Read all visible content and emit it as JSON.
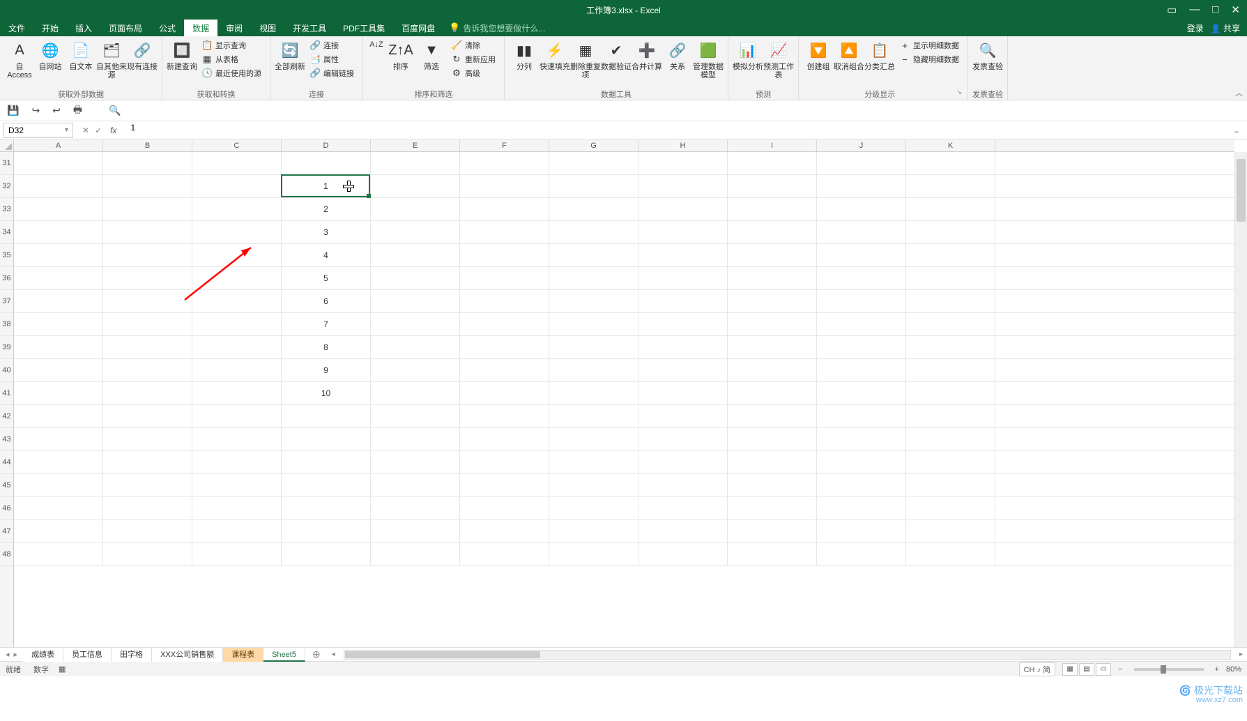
{
  "title_bar": {
    "document_title": "工作簿3.xlsx - Excel",
    "ribbon_options_icon": "▭",
    "minimize": "—",
    "maximize": "□",
    "close": "✕"
  },
  "tabs": {
    "items": [
      "文件",
      "开始",
      "插入",
      "页面布局",
      "公式",
      "数据",
      "审阅",
      "视图",
      "开发工具",
      "PDF工具集",
      "百度网盘"
    ],
    "active_index": 5,
    "tell_me_placeholder": "告诉我您想要做什么...",
    "login": "登录",
    "share": "共享"
  },
  "ribbon": {
    "groups": [
      {
        "label": "获取外部数据",
        "big": [
          {
            "label": "自 Access",
            "icon": "A",
            "name": "from-access-button"
          },
          {
            "label": "自网站",
            "icon": "🌐",
            "name": "from-web-button"
          },
          {
            "label": "自文本",
            "icon": "📄",
            "name": "from-text-button"
          },
          {
            "label": "自其他来源",
            "icon": "🗂",
            "name": "from-other-sources-button"
          },
          {
            "label": "现有连接",
            "icon": "🔗",
            "name": "existing-connections-button"
          }
        ],
        "stack": []
      },
      {
        "label": "获取和转换",
        "big": [
          {
            "label": "新建查询",
            "icon": "🔲",
            "name": "new-query-button"
          }
        ],
        "stack": [
          {
            "label": "显示查询",
            "icon": "📋",
            "name": "show-queries-button"
          },
          {
            "label": "从表格",
            "icon": "▦",
            "name": "from-table-button"
          },
          {
            "label": "最近使用的源",
            "icon": "🕓",
            "name": "recent-sources-button"
          }
        ]
      },
      {
        "label": "连接",
        "big": [
          {
            "label": "全部刷新",
            "icon": "🔄",
            "name": "refresh-all-button"
          }
        ],
        "stack": [
          {
            "label": "连接",
            "icon": "🔗",
            "name": "connections-button"
          },
          {
            "label": "属性",
            "icon": "📑",
            "name": "properties-button"
          },
          {
            "label": "编辑链接",
            "icon": "🔗",
            "name": "edit-links-button"
          }
        ]
      },
      {
        "label": "排序和筛选",
        "big": [
          {
            "label": "",
            "icon": "A↓Z",
            "name": "sort-az-button",
            "mini": true
          },
          {
            "label": "排序",
            "icon": "Z↑A",
            "name": "sort-dialog-button"
          },
          {
            "label": "筛选",
            "icon": "▼",
            "name": "filter-button"
          }
        ],
        "stack": [
          {
            "label": "清除",
            "icon": "🧹",
            "name": "clear-filter-button"
          },
          {
            "label": "重新应用",
            "icon": "↻",
            "name": "reapply-button"
          },
          {
            "label": "高级",
            "icon": "⚙",
            "name": "advanced-filter-button"
          }
        ]
      },
      {
        "label": "数据工具",
        "big": [
          {
            "label": "分列",
            "icon": "▮▮",
            "name": "text-to-columns-button"
          },
          {
            "label": "快速填充",
            "icon": "⚡",
            "name": "flash-fill-button"
          },
          {
            "label": "删除重复项",
            "icon": "▦",
            "name": "remove-duplicates-button"
          },
          {
            "label": "数据验证",
            "icon": "✔",
            "name": "data-validation-button"
          },
          {
            "label": "合并计算",
            "icon": "➕",
            "name": "consolidate-button"
          },
          {
            "label": "关系",
            "icon": "🔗",
            "name": "relationships-button"
          },
          {
            "label": "管理数据模型",
            "icon": "🟩",
            "name": "manage-data-model-button"
          }
        ],
        "stack": []
      },
      {
        "label": "预测",
        "big": [
          {
            "label": "模拟分析",
            "icon": "📊",
            "name": "what-if-analysis-button"
          },
          {
            "label": "预测工作表",
            "icon": "📈",
            "name": "forecast-sheet-button"
          }
        ],
        "stack": []
      },
      {
        "label": "分级显示",
        "big": [
          {
            "label": "创建组",
            "icon": "🔽",
            "name": "group-button"
          },
          {
            "label": "取消组合",
            "icon": "🔼",
            "name": "ungroup-button"
          },
          {
            "label": "分类汇总",
            "icon": "📋",
            "name": "subtotal-button"
          }
        ],
        "stack": [
          {
            "label": "显示明细数据",
            "icon": "+",
            "name": "show-detail-button"
          },
          {
            "label": "隐藏明细数据",
            "icon": "−",
            "name": "hide-detail-button"
          }
        ],
        "launcher": true
      },
      {
        "label": "发票查验",
        "big": [
          {
            "label": "发票查验",
            "icon": "🔍",
            "name": "invoice-check-button"
          }
        ],
        "stack": []
      }
    ],
    "collapse_icon": "︿"
  },
  "qat": {
    "items": [
      {
        "name": "save-button",
        "glyph": "💾"
      },
      {
        "name": "redo-button",
        "glyph": "↪"
      },
      {
        "name": "undo-button",
        "glyph": "↩"
      },
      {
        "name": "quick-print-button",
        "glyph": "🖶"
      },
      {
        "name": "print-preview-button",
        "glyph": "🔍"
      }
    ]
  },
  "formula": {
    "name_box": "D32",
    "fx_label": "fx",
    "value": "1"
  },
  "grid": {
    "columns": [
      "A",
      "B",
      "C",
      "D",
      "E",
      "F",
      "G",
      "H",
      "I",
      "J",
      "K"
    ],
    "first_row": 31,
    "row_count": 18,
    "cells": {
      "D32": "1",
      "D33": "2",
      "D34": "3",
      "D35": "4",
      "D36": "5",
      "D37": "6",
      "D38": "7",
      "D39": "8",
      "D40": "9",
      "D41": "10"
    },
    "active_cell": "D32"
  },
  "sheet_tabs": {
    "items": [
      "成绩表",
      "员工信息",
      "田字格",
      "XXX公司销售额",
      "课程表",
      "Sheet5"
    ],
    "active_index": 5,
    "highlighted_index": 4,
    "add_icon": "⊕"
  },
  "status_bar": {
    "ready": "就绪",
    "mode": "数字",
    "macro_icon": "▦",
    "ime": "CH ♪ 简",
    "zoom": "80%",
    "slider_minus": "−",
    "slider_plus": "+"
  },
  "watermark": {
    "line1": "极光下载站",
    "line2": "www.xz7.com"
  }
}
